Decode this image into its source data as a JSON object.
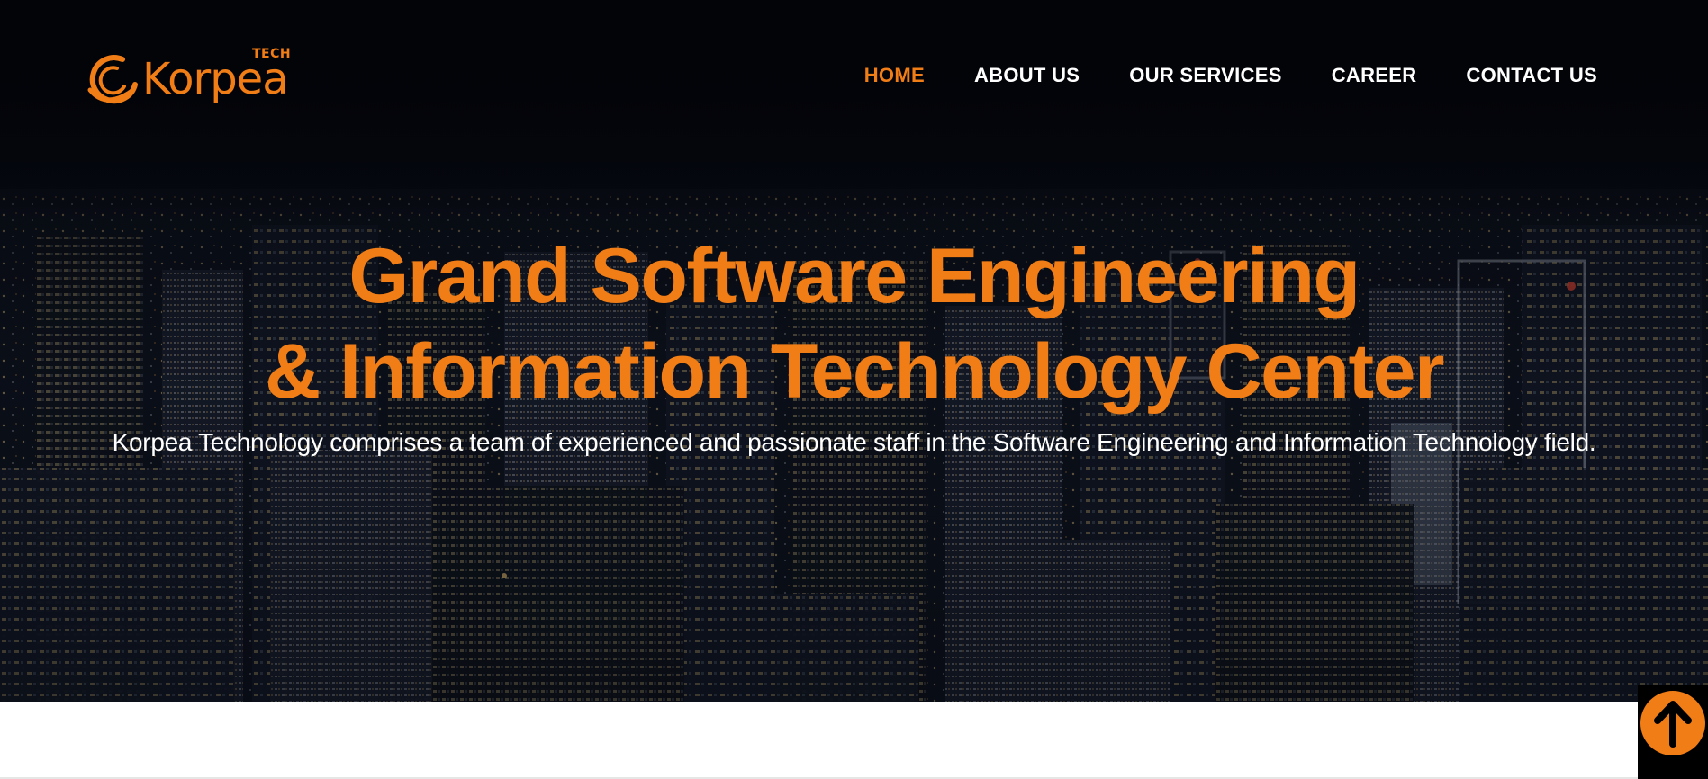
{
  "brand": {
    "name": "Korpea",
    "sup": "TECH",
    "accent_color": "#f07d16"
  },
  "nav": {
    "items": [
      {
        "label": "HOME",
        "active": true
      },
      {
        "label": "ABOUT US",
        "active": false
      },
      {
        "label": "OUR SERVICES",
        "active": false
      },
      {
        "label": "CAREER",
        "active": false
      },
      {
        "label": "CONTACT US",
        "active": false
      }
    ]
  },
  "hero": {
    "headline_line1": "Grand Software Engineering",
    "headline_line2": "& Information Technology Center",
    "subtitle": "Korpea Technology comprises a team of experienced and passionate staff in the Software Engineering and Information Technology field.",
    "background": "night-city-skyline"
  },
  "scroll_top": {
    "icon": "arrow-up-icon"
  }
}
